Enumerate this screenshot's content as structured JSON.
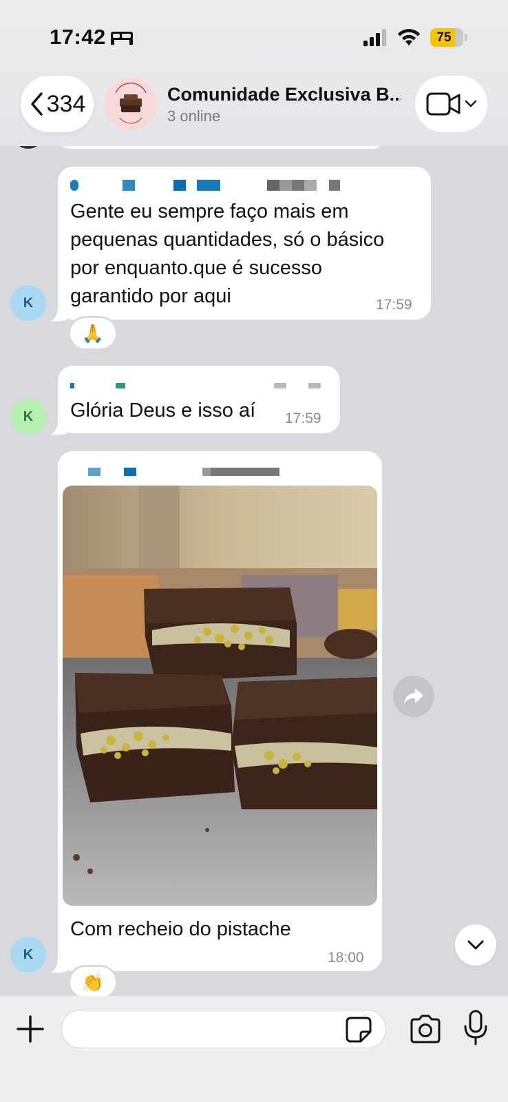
{
  "status_bar": {
    "time": "17:42",
    "battery_level": "75",
    "battery_fraction": 0.75,
    "icons": [
      "bed-icon",
      "signal-icon",
      "wifi-icon",
      "battery-icon"
    ]
  },
  "header": {
    "back_count": "334",
    "title": "Comunidade Exclusiva B...",
    "subtitle": "3 online",
    "avatar_icon": "group-avatar-brownie-logo",
    "video_icon": "video-call-icon"
  },
  "messages": [
    {
      "sender_initial": "K",
      "avatar_color": "#a9d8f5",
      "text": "Gente eu sempre faço mais em pequenas quantidades, só o básico por enquanto.que é sucesso garantido por aqui",
      "lines": [
        "Gente eu sempre faço mais em",
        "pequenas quantidades, só o básico",
        "por enquanto.que é sucesso",
        "garantido por aqui"
      ],
      "time": "17:59",
      "reaction": "🙏"
    },
    {
      "sender_initial": "K",
      "avatar_color": "#b5f0b0",
      "text": "Glória Deus e isso aí",
      "time": "17:59"
    },
    {
      "sender_initial": "K",
      "avatar_color": "#a9d8f5",
      "image_icon": "brownie-photo",
      "caption": "Com recheio do pistache",
      "time": "18:00",
      "reaction": "👏"
    }
  ],
  "input": {
    "placeholder": "",
    "value": ""
  },
  "colors": {
    "background": "#d8d9dd",
    "bubble": "#ffffff",
    "sender_blue": "#1a7bbf",
    "time_gray": "#8a8a8e",
    "battery_yellow": "#f7c400"
  }
}
